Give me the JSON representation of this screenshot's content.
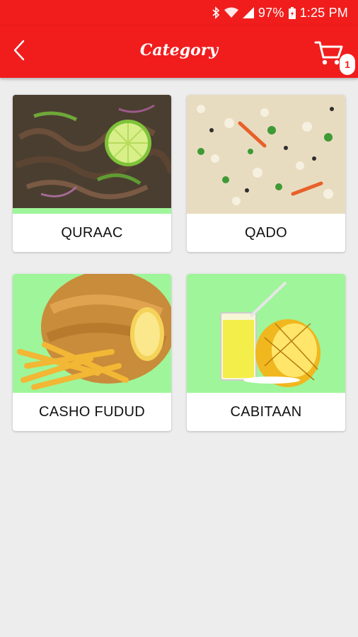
{
  "status_bar": {
    "battery": "97%",
    "time": "1:25 PM",
    "icons": [
      "bluetooth-icon",
      "wifi-icon",
      "signal-icon",
      "battery-icon"
    ]
  },
  "header": {
    "title": "Category",
    "back_icon": "back-arrow-icon",
    "cart_icon": "cart-icon",
    "cart_count": "1",
    "color": "#f11d1d"
  },
  "categories": [
    {
      "label": "QURAAC"
    },
    {
      "label": "QADO"
    },
    {
      "label": "CASHO FUDUD"
    },
    {
      "label": "CABITAAN"
    }
  ],
  "colors": {
    "accent": "#f11d1d",
    "background": "#ededed",
    "image_bg": "#9ff59a"
  }
}
